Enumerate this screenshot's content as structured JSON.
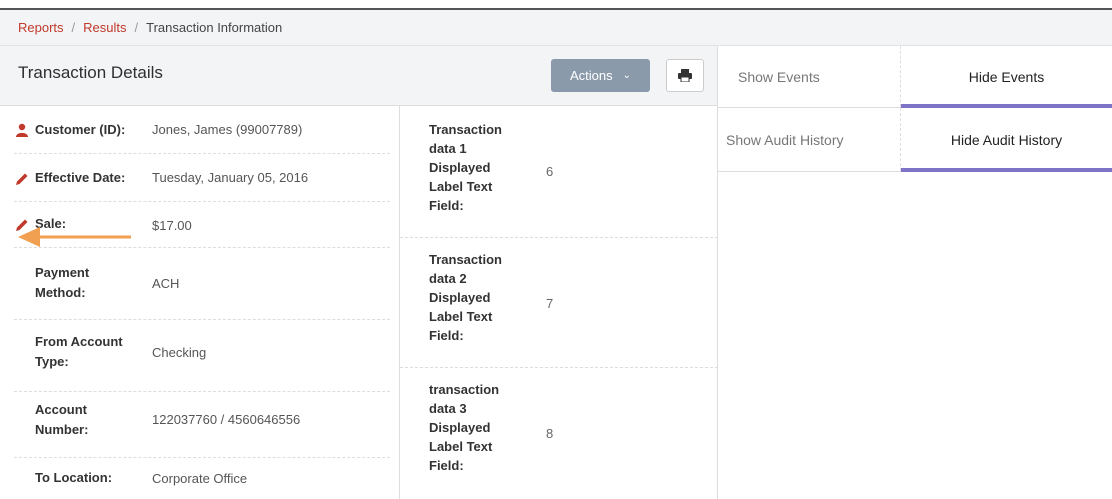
{
  "breadcrumb": {
    "items": [
      {
        "label": "Reports",
        "link": true
      },
      {
        "label": "Results",
        "link": true
      },
      {
        "label": "Transaction Information",
        "link": false
      }
    ],
    "separator": "/"
  },
  "details": {
    "title": "Transaction Details",
    "actions_label": "Actions",
    "print_icon": "print-icon"
  },
  "fields": [
    {
      "label": "Customer (ID):",
      "value": "Jones, James (99007789)",
      "icon": "user-icon"
    },
    {
      "label": "Effective Date:",
      "value": "Tuesday, January 05, 2016",
      "icon": "pencil-icon"
    },
    {
      "label": "Sale:",
      "value": "$17.00",
      "icon": "pencil-icon"
    },
    {
      "label": "Payment Method:",
      "value": "ACH"
    },
    {
      "label": "From Account Type:",
      "value": "Checking"
    },
    {
      "label": "Account Number:",
      "value": "122037760 / 4560646556"
    },
    {
      "label": "To Location:",
      "value": "Corporate Office"
    }
  ],
  "custom_fields": [
    {
      "label": "Transaction data 1 Displayed Label Text Field:",
      "value": "6"
    },
    {
      "label": "Transaction data 2 Displayed Label Text Field:",
      "value": "7"
    },
    {
      "label": "transaction data 3 Displayed Label Text Field:",
      "value": "8"
    }
  ],
  "events_tabs": {
    "show": "Show Events",
    "hide": "Hide Events"
  },
  "audit_tabs": {
    "show": "Show Audit History",
    "hide": "Hide Audit History"
  },
  "colors": {
    "link": "#c0392b",
    "icon": "#c0392b",
    "accent": "#7d74c8",
    "button": "#8a9aab",
    "annotation_arrow": "#f0a050"
  }
}
